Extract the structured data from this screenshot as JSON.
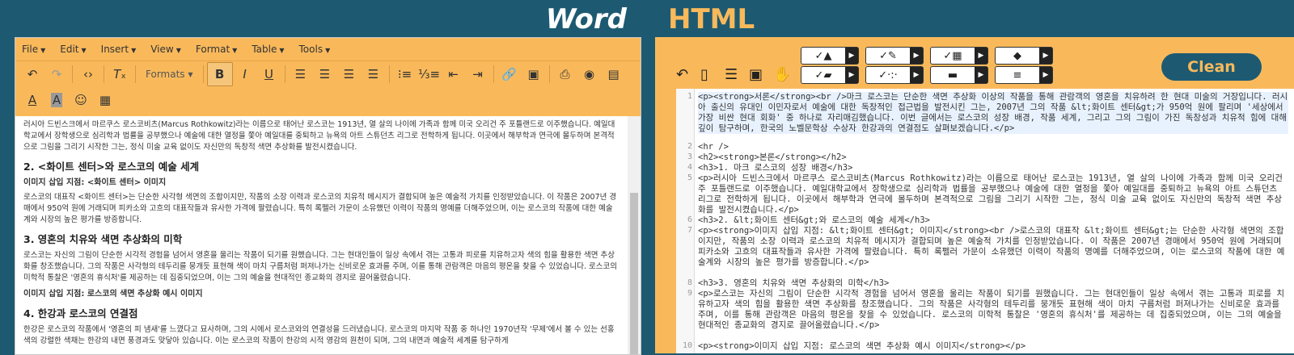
{
  "word": {
    "title": "Word",
    "menus": [
      {
        "label": "File"
      },
      {
        "label": "Edit"
      },
      {
        "label": "Insert"
      },
      {
        "label": "View"
      },
      {
        "label": "Format"
      },
      {
        "label": "Table"
      },
      {
        "label": "Tools"
      }
    ],
    "formats_label": "Formats",
    "content": {
      "p1": "러시아 드빈스크에서 마르쿠스 로스코비츠(Marcus Rothkowitz)라는 이름으로 태어난 로스코는 1913년, 열 살의 나이에 가족과 함께 미국 오리건 주 포틀랜드로 이주했습니다. 예일대학교에서 장학생으로 심리학과 법률을 공부했으나 예술에 대한 열정을 쫓아 예일대를 중퇴하고 뉴욕의 아트 스튜던츠 리그로 전학하게 됩니다. 이곳에서 해부학과 연극에 몰두하며 본격적으로 그림을 그리기 시작한 그는, 정식 미술 교육 없이도 자신만의 독창적 색면 추상화를 발전시켰습니다.",
      "h2": "2. <화이트 센터>와 로스코의 예술 세계",
      "ins1": "이미지 삽입 지점: <화이트 센터> 이미지",
      "p2": "로스코의 대표작 <화이트 센터>는 단순한 사각형 색면의 조합이지만, 작품의 소장 이력과 로스코의 치유적 메시지가 결합되며 높은 예술적 가치를 인정받았습니다. 이 작품은 2007년 경매에서 950억 원에 거래되며 피카소와 고흐의 대표작들과 유사한 가격에 팔렸습니다. 특히 록펠러 가문이 소유했던 이력이 작품의 명예를 더해주었으며, 이는 로스코의 작품에 대한 예술계와 시장의 높은 평가를 방증합니다.",
      "h3": "3. 영혼의 치유와 색면 추상화의 미학",
      "p3": "로스코는 자신의 그림이 단순한 시각적 경험을 넘어서 영혼을 울리는 작품이 되기를 원했습니다. 그는 현대인들이 일상 속에서 겪는 고통과 피로를 치유하고자 색의 힘을 활용한 색면 추상화를 창조했습니다. 그의 작품은 사각형의 테두리를 뭉개듯 표현해 색이 마치 구름처럼 퍼져나가는 신비로운 효과를 주며, 이를 통해 관람객은 마음의 평온을 찾을 수 있었습니다. 로스코의 미학적 통찰은 '영혼의 휴식처'를 제공하는 데 집중되었으며, 이는 그의 예술을 현대적인 종교화의 경지로 끌어올렸습니다.",
      "ins2": "이미지 삽입 지점: 로스코의 색면 추상화 예시 이미지",
      "h4": "4. 한강과 로스코의 연결점",
      "p4": "한강은 로스코의 작품에서 '영혼의 피 냄새'를 느꼈다고 묘사하며, 그의 시에서 로스코와의 연결성을 드러냈습니다. 로스코의 마지막 작품 중 하나인 1970년작 '무제'에서 볼 수 있는 선홍색의 강렬한 색채는 한강의 내면 풍경과도 맞닿아 있습니다. 이는 로스코의 작품이 한강의 시적 영감의 원천이 되며, 그의 내면과 예술적 세계를 탐구하게"
    }
  },
  "html": {
    "title": "HTML",
    "clean_label": "Clean",
    "lines": [
      {
        "n": "1",
        "text": "<p><strong>서론</strong><br />마크 로스코는 단순한 색면 추상화 이상의 작품을 통해 관람객의 영혼을 치유하려 한 현대 미술의 거장입니다. 러시아 출신의 유대인 이민자로서 예술에 대한 독창적인 접근법을 발전시킨 그는, 2007년 그의 작품 &lt;화이트 센터&gt;가 950억 원에 팔리며 '세상에서 가장 비싼 현대 회화' 중 하나로 자리매김했습니다. 이번 글에서는 로스코의 성장 배경, 작품 세계, 그리고 그의 그림이 가진 독창성과 치유적 힘에 대해 깊이 탐구하며, 한국의 노벨문학상 수상자 한강과의 연결점도 살펴보겠습니다.</p>"
      },
      {
        "n": "2",
        "text": "<hr />"
      },
      {
        "n": "3",
        "text": "<h2><strong>본론</strong></h2>"
      },
      {
        "n": "4",
        "text": "<h3>1. 마크 로스코의 성장 배경</h3>"
      },
      {
        "n": "5",
        "text": "<p>러시아 드빈스크에서 마르쿠스 로스코비츠(Marcus Rothkowitz)라는 이름으로 태어난 로스코는 1913년, 열 살의 나이에 가족과 함께 미국 오리건 주 포틀랜드로 이주했습니다. 예일대학교에서 장학생으로 심리학과 법률을 공부했으나 예술에 대한 열정을 쫓아 예일대를 중퇴하고 뉴욕의 아트 스튜던츠 리그로 전학하게 됩니다. 이곳에서 해부학과 연극에 몰두하며 본격적으로 그림을 그리기 시작한 그는, 정식 미술 교육 없이도 자신만의 독창적 색면 추상화를 발전시켰습니다.</p>"
      },
      {
        "n": "6",
        "text": "<h3>2. &lt;화이트 센터&gt;와 로스코의 예술 세계</h3>"
      },
      {
        "n": "7",
        "text": "<p><strong>이미지 삽입 지점: &lt;화이트 센터&gt; 이미지</strong><br />로스코의 대표작 &lt;화이트 센터&gt;는 단순한 사각형 색면의 조합이지만, 작품의 소장 이력과 로스코의 치유적 메시지가 결합되며 높은 예술적 가치를 인정받았습니다. 이 작품은 2007년 경매에서 950억 원에 거래되며 피카소와 고흐의 대표작들과 유사한 가격에 팔렸습니다. 특히 록펠러 가문이 소유했던 이력이 작품의 명예를 더해주었으며, 이는 로스코의 작품에 대한 예술계와 시장의 높은 평가를 방증합니다.</p>"
      },
      {
        "n": "8",
        "text": "<h3>3. 영혼의 치유와 색면 추상화의 미학</h3>"
      },
      {
        "n": "9",
        "text": "<p>로스코는 자신의 그림이 단순한 시각적 경험을 넘어서 영혼을 울리는 작품이 되기를 원했습니다. 그는 현대인들이 일상 속에서 겪는 고통과 피로를 치유하고자 색의 힘을 활용한 색면 추상화를 창조했습니다. 그의 작품은 사각형의 테두리를 뭉개듯 표현해 색이 마치 구름처럼 퍼져나가는 신비로운 효과를 주며, 이를 통해 관람객은 마음의 평온을 찾을 수 있었습니다. 로스코의 미학적 통찰은 '영혼의 휴식처'를 제공하는 데 집중되었으며, 이는 그의 예술을 현대적인 종교화의 경지로 끌어올렸습니다.</p>"
      },
      {
        "n": "10",
        "text": "<p><strong>이미지 삽입 지점: 로스코의 색면 추상화 예시 이미지</strong></p>"
      }
    ]
  }
}
